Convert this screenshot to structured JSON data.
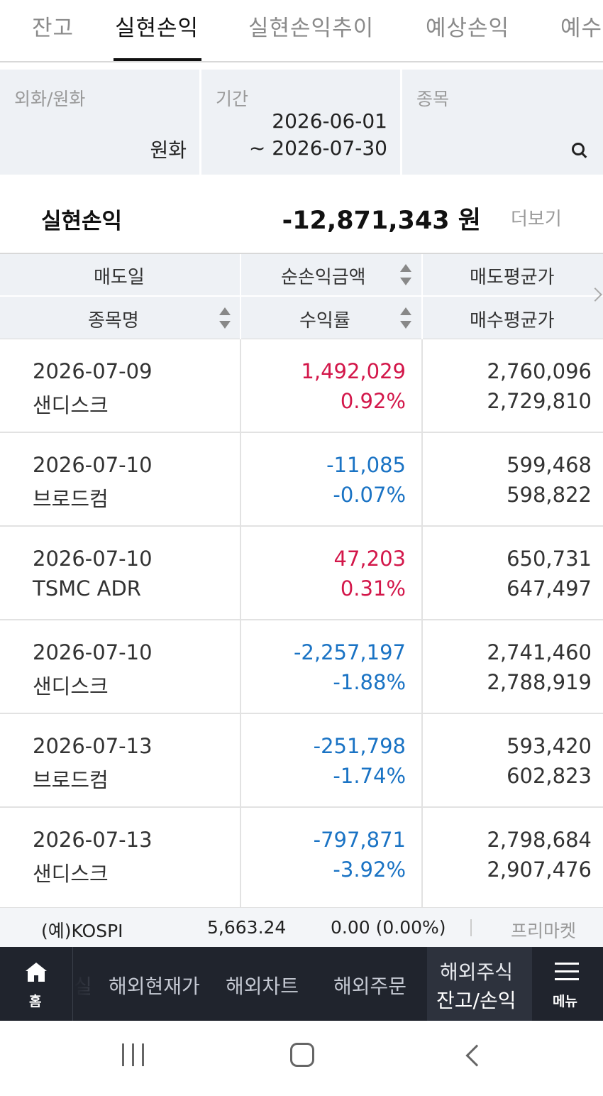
{
  "tabs": [
    "잔고",
    "실현손익",
    "실현손익추이",
    "예상손익",
    "예수"
  ],
  "filter": {
    "currency_label": "외화/원화",
    "currency_value": "원화",
    "period_label": "기간",
    "period_from": "2026-06-01",
    "period_to": "~ 2026-07-30",
    "stock_label": "종목"
  },
  "summary": {
    "label": "실현손익",
    "value": "-12,871,343 원",
    "more": "더보기"
  },
  "table_header": {
    "sell_date": "매도일",
    "net_pl": "순손익금액",
    "sell_avg": "매도평균가",
    "stock_name": "종목명",
    "return_rate": "수익률",
    "buy_avg": "매수평균가"
  },
  "rows": [
    {
      "date": "2026-07-09",
      "name": "샌디스크",
      "pl": "1,492,029",
      "rate": "0.92%",
      "sell": "2,760,096",
      "buy": "2,729,810",
      "sign": "pos"
    },
    {
      "date": "2026-07-10",
      "name": "브로드컴",
      "pl": "-11,085",
      "rate": "-0.07%",
      "sell": "599,468",
      "buy": "598,822",
      "sign": "neg"
    },
    {
      "date": "2026-07-10",
      "name": "TSMC ADR",
      "pl": "47,203",
      "rate": "0.31%",
      "sell": "650,731",
      "buy": "647,497",
      "sign": "pos"
    },
    {
      "date": "2026-07-10",
      "name": "샌디스크",
      "pl": "-2,257,197",
      "rate": "-1.88%",
      "sell": "2,741,460",
      "buy": "2,788,919",
      "sign": "neg"
    },
    {
      "date": "2026-07-13",
      "name": "브로드컴",
      "pl": "-251,798",
      "rate": "-1.74%",
      "sell": "593,420",
      "buy": "602,823",
      "sign": "neg"
    },
    {
      "date": "2026-07-13",
      "name": "샌디스크",
      "pl": "-797,871",
      "rate": "-3.92%",
      "sell": "2,798,684",
      "buy": "2,907,476",
      "sign": "neg"
    }
  ],
  "colors": {
    "positive": "#d3174a",
    "negative": "#1a73c4",
    "header_bg": "#eef1f5",
    "nav_bg": "#20242d"
  },
  "ticker": {
    "name": "(예)KOSPI",
    "value": "5,663.24",
    "change": "0.00 (0.00%)",
    "premarket": "프리마켓"
  },
  "app_nav": {
    "home": "홈",
    "cut_item": "실",
    "items": [
      "해외현재가",
      "해외차트",
      "해외주문"
    ],
    "active_line1": "해외주식",
    "active_line2": "잔고/손익",
    "menu": "메뉴"
  }
}
